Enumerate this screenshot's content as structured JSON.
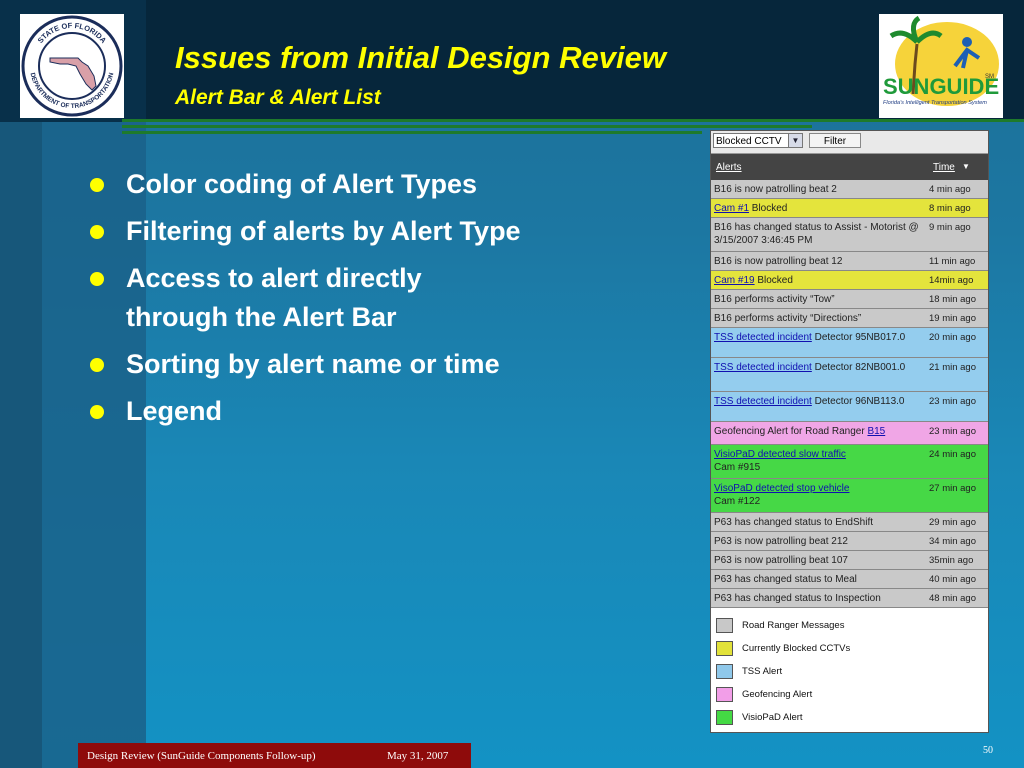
{
  "slide": {
    "title": "Issues from Initial Design Review",
    "subtitle": "Alert Bar & Alert List",
    "bullets": [
      "Color coding of Alert Types",
      "Filtering of alerts by Alert Type",
      "Access to alert directly through the Alert Bar",
      "Sorting by alert name or time",
      "Legend"
    ],
    "footer_text": "Design Review (SunGuide Components Follow-up)",
    "footer_date": "May 31, 2007",
    "page_number": "50"
  },
  "logos": {
    "left_text": "STATE OF FLORIDA DEPARTMENT OF TRANSPORTATION",
    "right_text": "SUNGUIDE",
    "right_sub": "Florida's Intelligent Transportation System",
    "right_sm": "SM"
  },
  "panel": {
    "filter_select_value": "Blocked CCTV",
    "filter_button": "Filter",
    "col_alerts": "Alerts",
    "col_time": "Time",
    "rows": [
      {
        "type": "gray",
        "text": "B16 is now patrolling beat 2",
        "time": "4 min ago"
      },
      {
        "type": "yellow",
        "link": "Cam #1",
        "text": " Blocked",
        "time": "8 min ago"
      },
      {
        "type": "gray",
        "text": "B16 has changed status to Assist - Motorist @ 3/15/2007 3:46:45 PM",
        "time": "9 min ago"
      },
      {
        "type": "gray",
        "text": "B16 is now patrolling beat 12",
        "time": "11 min ago"
      },
      {
        "type": "yellow",
        "link": "Cam #19",
        "text": " Blocked",
        "time": "14min ago"
      },
      {
        "type": "gray",
        "text": "B16 performs activity “Tow”",
        "time": "18 min ago"
      },
      {
        "type": "gray",
        "text": "B16 performs activity “Directions”",
        "time": "19 min ago"
      },
      {
        "type": "blue",
        "link": "TSS detected incident",
        "text": " Detector 95NB017.0",
        "time": "20 min ago"
      },
      {
        "type": "blue",
        "link": "TSS detected incident",
        "text": " Detector 82NB001.0",
        "time": "21 min ago"
      },
      {
        "type": "blue",
        "link": "TSS detected incident",
        "text": " Detector 96NB113.0",
        "time": "23 min ago"
      },
      {
        "type": "pink",
        "text": "Geofencing Alert for Road Ranger ",
        "link_after": "B15",
        "time": "23 min ago"
      },
      {
        "type": "green",
        "link": "VisioPaD detected slow traffic",
        "text": "Cam #915",
        "time": "24 min ago"
      },
      {
        "type": "green",
        "link": "VisoPaD detected stop vehicle",
        "text": "Cam #122",
        "time": "27 min ago"
      },
      {
        "type": "gray",
        "text": "P63 has changed status to EndShift",
        "time": "29 min ago"
      },
      {
        "type": "gray",
        "text": "P63 is now patrolling beat 212",
        "time": "34 min ago"
      },
      {
        "type": "gray",
        "text": "P63 is now patrolling beat 107",
        "time": "35min ago"
      },
      {
        "type": "gray",
        "text": "P63 has changed status to Meal",
        "time": "40 min ago"
      },
      {
        "type": "gray",
        "text": "P63 has changed status to Inspection",
        "time": "48 min ago"
      }
    ],
    "legend": [
      {
        "label": "Road Ranger Messages",
        "color": "#c8c8c8"
      },
      {
        "label": "Currently Blocked CCTVs",
        "color": "#e2e23a"
      },
      {
        "label": "TSS Alert",
        "color": "#8fc8ea"
      },
      {
        "label": "Geofencing Alert",
        "color": "#f29ee8"
      },
      {
        "label": "VisioPaD Alert",
        "color": "#44d944"
      }
    ]
  },
  "colors": {
    "gray": "#c9c9c9",
    "yellow": "#e4e43c",
    "blue": "#94cdee",
    "pink": "#f0a6e6",
    "green": "#46d846",
    "title": "#ffff00",
    "footer_bg": "#8e0b0b"
  }
}
